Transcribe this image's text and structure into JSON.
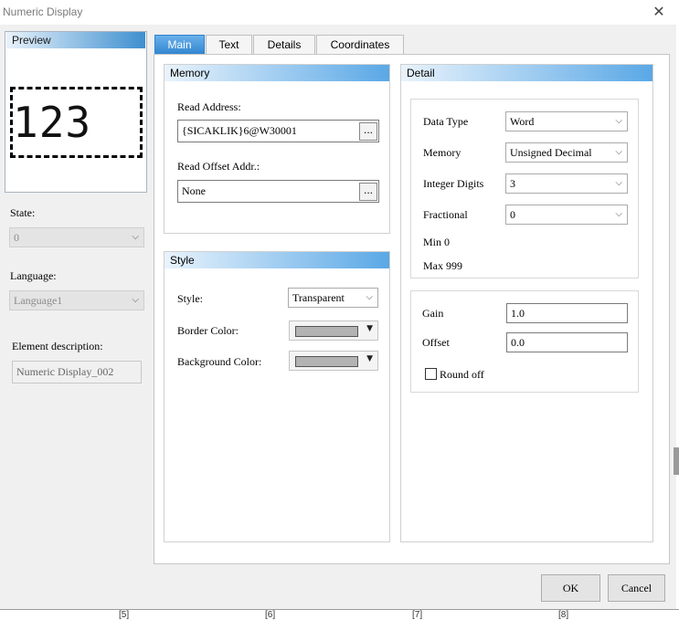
{
  "window": {
    "title": "Numeric Display",
    "close_glyph": "✕"
  },
  "preview": {
    "header": "Preview",
    "display_value": "123"
  },
  "left": {
    "state_label": "State:",
    "state_value": "0",
    "language_label": "Language:",
    "language_value": "Language1",
    "desc_label": "Element description:",
    "desc_value": "Numeric Display_002"
  },
  "tabs": [
    {
      "label": "Main",
      "active": true
    },
    {
      "label": "Text"
    },
    {
      "label": "Details"
    },
    {
      "label": "Coordinates"
    }
  ],
  "memory": {
    "header": "Memory",
    "read_address_label": "Read Address:",
    "read_address_value": "{SICAKLIK}6@W30001",
    "read_offset_label": "Read Offset Addr.:",
    "read_offset_value": "None",
    "browse_label": "..."
  },
  "style": {
    "header": "Style",
    "style_label": "Style:",
    "style_value": "Transparent",
    "border_color_label": "Border Color:",
    "background_color_label": "Background Color:",
    "border_color": "#b3b3b3",
    "background_color": "#b3b3b3"
  },
  "detail": {
    "header": "Detail",
    "data_type_label": "Data Type",
    "data_type_value": "Word",
    "memory_label": "Memory",
    "memory_value": "Unsigned Decimal",
    "integer_digits_label": "Integer Digits",
    "integer_digits_value": "3",
    "fractional_label": "Fractional",
    "fractional_value": "0",
    "min_text": "Min 0",
    "max_text": "Max 999",
    "gain_label": "Gain",
    "gain_value": "1.0",
    "offset_label": "Offset",
    "offset_value": "0.0",
    "round_off_label": "Round off",
    "round_off_checked": false
  },
  "buttons": {
    "ok": "OK",
    "cancel": "Cancel"
  },
  "ruler": [
    "[5]",
    "[6]",
    "[7]",
    "[8]"
  ],
  "icons": {
    "dropdown": "chevron-down-icon",
    "close": "close-icon",
    "color_dropdown": "triangle-down-icon"
  },
  "colors": {
    "accent": "#2f84cf",
    "header_gradient_end": "#5aa8e6"
  }
}
